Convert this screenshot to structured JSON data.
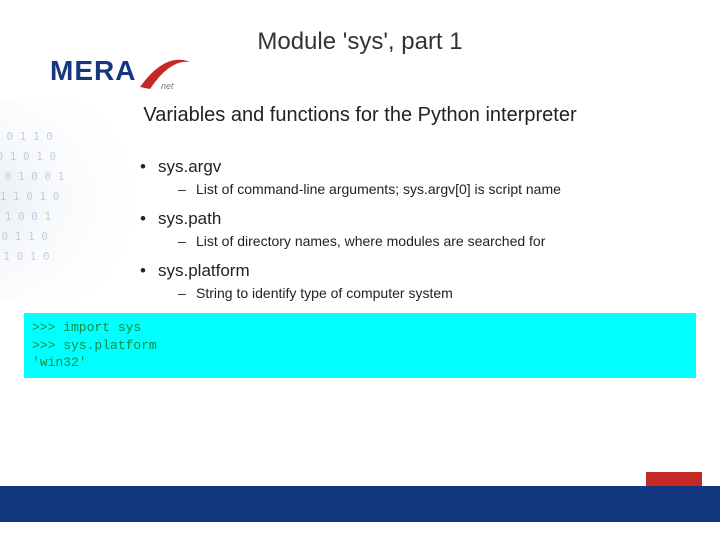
{
  "title": "Module 'sys', part 1",
  "subtitle": "Variables and functions for the Python interpreter",
  "logo": {
    "text": "MERA"
  },
  "items": [
    {
      "name": "sys.argv",
      "desc": "List of command-line arguments; sys.argv[0] is script name"
    },
    {
      "name": "sys.path",
      "desc": "List of directory names, where modules are searched for"
    },
    {
      "name": "sys.platform",
      "desc": "String to identify type of computer system"
    }
  ],
  "code": ">>> import sys\n>>> sys.platform\n'win32'"
}
